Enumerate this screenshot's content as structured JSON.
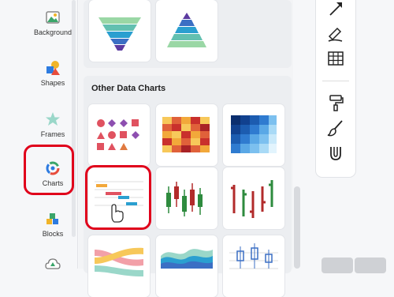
{
  "sidebar": {
    "items": [
      {
        "label": "Background",
        "icon": "image-icon"
      },
      {
        "label": "Shapes",
        "icon": "shapes-icon"
      },
      {
        "label": "Frames",
        "icon": "star-frame-icon"
      },
      {
        "label": "Charts",
        "icon": "chart-ring-icon",
        "selected": true
      },
      {
        "label": "Blocks",
        "icon": "blocks-icon"
      },
      {
        "label": "",
        "icon": "cloud-icon"
      }
    ]
  },
  "panel": {
    "section_title": "Other Data Charts",
    "top_tiles": [
      "funnel-chart",
      "pyramid-chart"
    ],
    "tiles": [
      "dot-matrix-chart",
      "heatmap-chart",
      "blue-heatmap-chart",
      "gantt-chart",
      "candlestick-chart",
      "ohlc-chart",
      "sankey-chart",
      "streamgraph-chart",
      "box-plot-chart"
    ]
  },
  "toolbar": {
    "tools": [
      "arrow-line-icon",
      "draw-pen-icon",
      "table-icon",
      "paint-roller-icon",
      "brush-icon",
      "magnet-icon"
    ]
  },
  "colors": {
    "highlight": "#e0001b"
  }
}
